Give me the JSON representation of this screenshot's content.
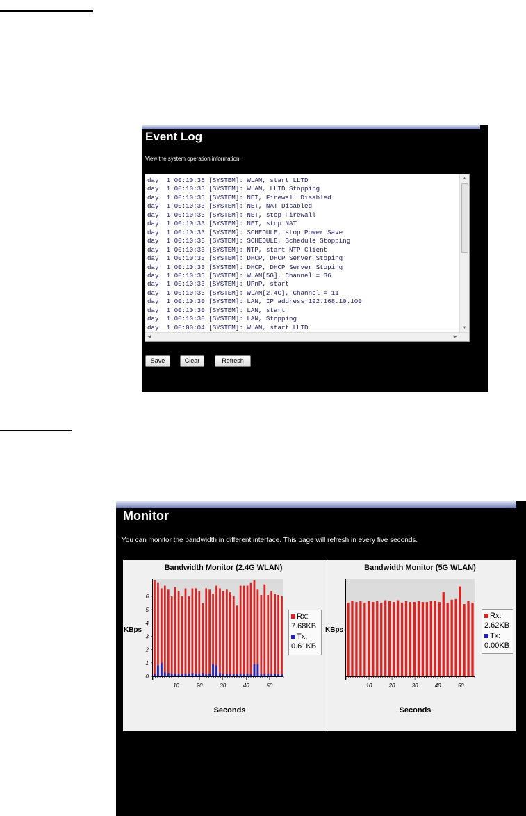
{
  "event_log": {
    "title": "Event Log",
    "description": "View the system operation information.",
    "lines": [
      "day  1 00:10:35 [SYSTEM]: WLAN, start LLTD",
      "day  1 00:10:33 [SYSTEM]: WLAN, LLTD Stopping",
      "day  1 00:10:33 [SYSTEM]: NET, Firewall Disabled",
      "day  1 00:10:33 [SYSTEM]: NET, NAT Disabled",
      "day  1 00:10:33 [SYSTEM]: NET, stop Firewall",
      "day  1 00:10:33 [SYSTEM]: NET, stop NAT",
      "day  1 00:10:33 [SYSTEM]: SCHEDULE, stop Power Save",
      "day  1 00:10:33 [SYSTEM]: SCHEDULE, Schedule Stopping",
      "day  1 00:10:33 [SYSTEM]: NTP, start NTP Client",
      "day  1 00:10:33 [SYSTEM]: DHCP, DHCP Server Stoping",
      "day  1 00:10:33 [SYSTEM]: DHCP, DHCP Server Stoping",
      "day  1 00:10:33 [SYSTEM]: WLAN[5G], Channel = 36",
      "day  1 00:10:33 [SYSTEM]: UPnP, start",
      "day  1 00:10:33 [SYSTEM]: WLAN[2.4G], Channel = 11",
      "day  1 00:10:30 [SYSTEM]: LAN, IP address=192.168.10.100",
      "day  1 00:10:30 [SYSTEM]: LAN, start",
      "day  1 00:10:30 [SYSTEM]: LAN, Stopping",
      "day  1 00:00:04 [SYSTEM]: WLAN, start LLTD"
    ],
    "buttons": {
      "save": "Save",
      "clear": "Clear",
      "refresh": "Refresh"
    }
  },
  "monitor": {
    "title": "Monitor",
    "description": "You can monitor the bandwidth in different interface. This page will refresh in every five seconds.",
    "colors": {
      "rx": "#dd2222",
      "tx": "#2222bb",
      "plot_bg": "#dcdcdc"
    }
  },
  "chart_data": [
    {
      "type": "bar",
      "title": "Bandwidth Monitor (2.4G WLAN)",
      "xlabel": "Seconds",
      "ylabel": "KBps",
      "ylim": [
        0,
        7.3
      ],
      "yticks": [
        "0",
        "1",
        "2",
        "3",
        "4",
        "5",
        "6"
      ],
      "xticks": [
        "10",
        "20",
        "30",
        "40",
        "50"
      ],
      "legend": {
        "rx_label": "Rx:",
        "rx_value": "7.68KB",
        "tx_label": "Tx:",
        "tx_value": "0.61KB"
      },
      "series": [
        {
          "name": "Rx",
          "values": [
            7.2,
            7.0,
            6.6,
            6.8,
            6.5,
            6.0,
            6.7,
            6.4,
            6.0,
            6.6,
            6.0,
            6.6,
            6.6,
            6.4,
            5.5,
            6.6,
            6.5,
            6.2,
            6.8,
            6.6,
            6.4,
            6.5,
            6.3,
            6.0,
            5.3,
            6.8,
            6.8,
            6.8,
            7.0,
            7.2,
            6.5,
            6.1,
            6.9,
            6.1,
            6.4,
            6.2,
            6.1,
            6.0
          ]
        },
        {
          "name": "Tx",
          "values": [
            0.15,
            0.8,
            1.0,
            0.3,
            0.25,
            0.2,
            0.2,
            0.15,
            0.2,
            0.2,
            0.2,
            0.25,
            0.2,
            0.2,
            0.25,
            0.15,
            0.2,
            0.9,
            0.8,
            0.25,
            0.15,
            0.2,
            0.15,
            0.15,
            0.15,
            0.2,
            0.15,
            0.2,
            0.15,
            0.9,
            0.9,
            0.2,
            0.15,
            0.2,
            0.15,
            0.2,
            0.15,
            0.15
          ]
        }
      ]
    },
    {
      "type": "bar",
      "title": "Bandwidth Monitor (5G WLAN)",
      "xlabel": "Seconds",
      "ylabel": "KBps",
      "xticks": [
        "10",
        "20",
        "30",
        "40",
        "50"
      ],
      "legend": {
        "rx_label": "Rx:",
        "rx_value": "2.62KB",
        "tx_label": "Tx:",
        "tx_value": "0.00KB"
      },
      "series": [
        {
          "name": "Rx",
          "values": [
            2.5,
            2.57,
            2.52,
            2.55,
            2.5,
            2.55,
            2.52,
            2.55,
            2.5,
            2.58,
            2.55,
            2.52,
            2.58,
            2.5,
            2.55,
            2.52,
            2.52,
            2.55,
            2.52,
            2.52,
            2.55,
            2.57,
            2.52,
            2.85,
            2.5,
            2.6,
            2.62,
            3.05,
            2.45,
            2.55,
            2.5
          ]
        },
        {
          "name": "Tx",
          "values": [
            0,
            0,
            0,
            0,
            0,
            0,
            0,
            0,
            0,
            0,
            0,
            0,
            0,
            0,
            0,
            0,
            0,
            0,
            0,
            0,
            0,
            0,
            0,
            0,
            0,
            0,
            0,
            0,
            0,
            0,
            0
          ]
        }
      ]
    }
  ]
}
